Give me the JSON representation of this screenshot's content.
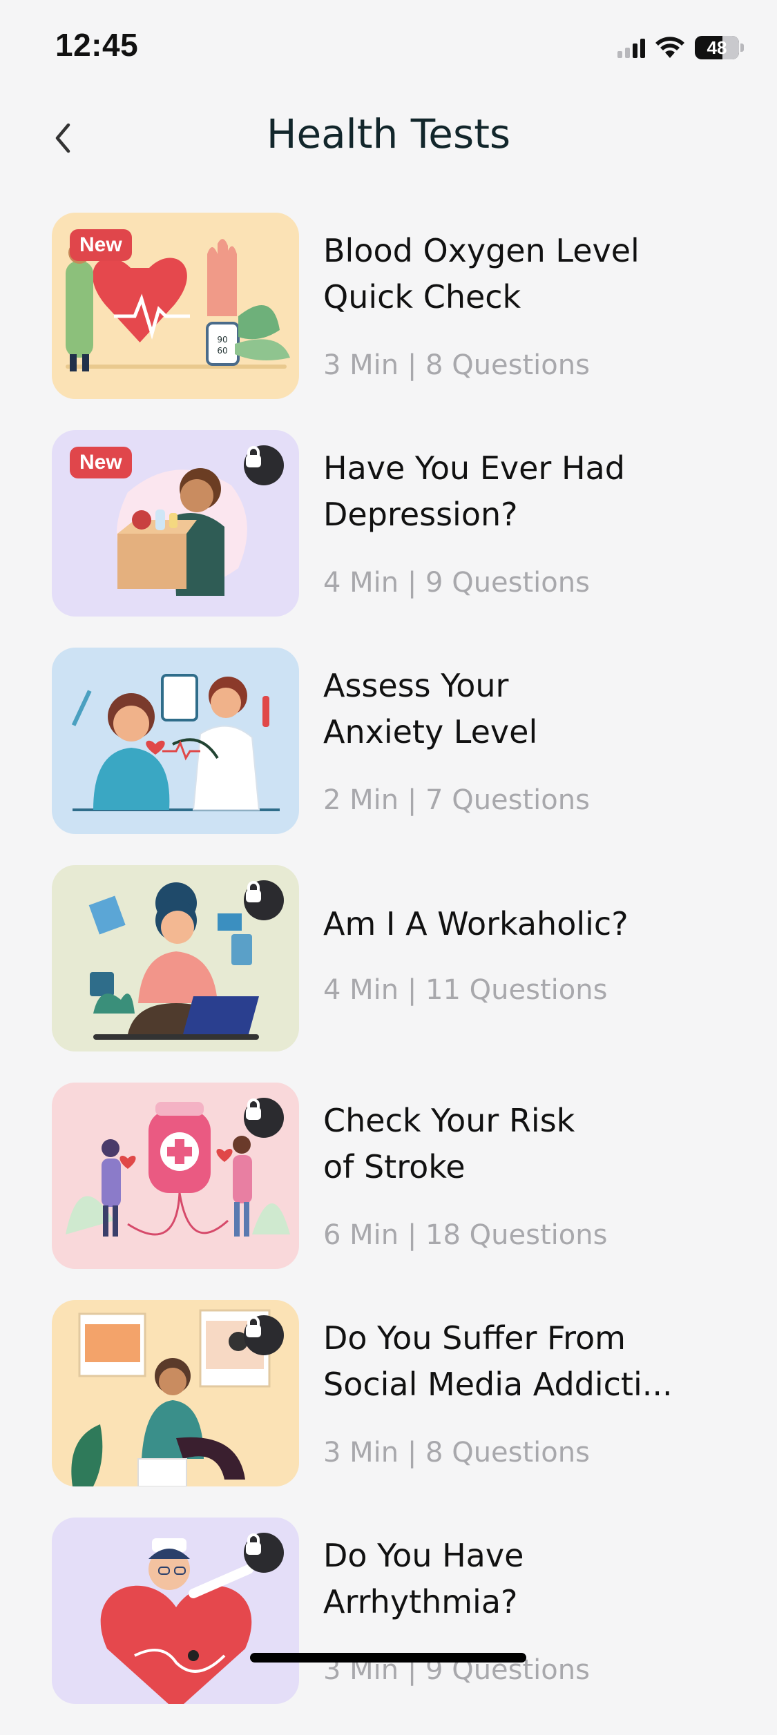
{
  "status_bar": {
    "time": "12:45",
    "battery_level": "48",
    "icons": [
      "cellular-signal-icon",
      "wifi-icon",
      "battery-icon"
    ]
  },
  "nav": {
    "title": "Health Tests",
    "back_icon": "chevron-left-icon"
  },
  "tests": [
    {
      "title": "Blood Oxygen Level\nQuick Check",
      "meta": "3 Min | 8 Questions",
      "badge": "New",
      "locked": false,
      "bg": "#fbe2b5",
      "image_icon": "heart-rate-illustration"
    },
    {
      "title": "Have You Ever Had\nDepression?",
      "meta": "4 Min | 9 Questions",
      "badge": "New",
      "locked": true,
      "bg": "#e4def8",
      "image_icon": "person-with-box-illustration"
    },
    {
      "title": "Assess Your\nAnxiety Level",
      "meta": "2 Min | 7 Questions",
      "badge": "",
      "locked": false,
      "bg": "#cde2f4",
      "image_icon": "doctor-checkup-illustration"
    },
    {
      "title": "Am I A Workaholic?",
      "meta": "4 Min | 11 Questions",
      "badge": "",
      "locked": true,
      "bg": "#e7ead3",
      "image_icon": "multitasking-woman-illustration"
    },
    {
      "title": "Check Your Risk\nof Stroke",
      "meta": "6 Min | 18 Questions",
      "badge": "",
      "locked": true,
      "bg": "#f9d8da",
      "image_icon": "blood-bag-illustration"
    },
    {
      "title": "Do You Suffer From\nSocial Media Addicti...",
      "meta": "3 Min | 8 Questions",
      "badge": "",
      "locked": true,
      "bg": "#fbe2b5",
      "image_icon": "social-media-illustration"
    },
    {
      "title": "Do You Have\nArrhythmia?",
      "meta": "3 Min | 9 Questions",
      "badge": "",
      "locked": true,
      "bg": "#e4def8",
      "image_icon": "heart-nurse-illustration"
    }
  ]
}
